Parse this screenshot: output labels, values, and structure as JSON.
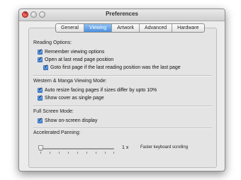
{
  "window": {
    "title": "Preferences"
  },
  "tabs": [
    {
      "label": "General"
    },
    {
      "label": "Viewing",
      "active": true
    },
    {
      "label": "Artwork"
    },
    {
      "label": "Advanced"
    },
    {
      "label": "Hardware"
    }
  ],
  "reading": {
    "title": "Reading Options:",
    "options": [
      {
        "label": "Remember viewing options",
        "checked": true
      },
      {
        "label": "Open at last read page position",
        "checked": true
      },
      {
        "label": "Goto first page if the last reading position was the last page",
        "checked": true
      }
    ]
  },
  "western": {
    "title": "Western & Manga Viewing Mode:",
    "options": [
      {
        "label": "Auto resize facing pages if sizes differ by upto 10%",
        "checked": true
      },
      {
        "label": "Show cover as single page",
        "checked": true
      }
    ]
  },
  "fullscreen": {
    "title": "Full Screen Mode:",
    "options": [
      {
        "label": "Show on-screen display",
        "checked": true
      }
    ]
  },
  "panning": {
    "title": "Accelerated Panning:",
    "value": "1 x",
    "caption": "Faster keyboard scrolling",
    "level": 0
  },
  "icons": {
    "check": "checkmark-icon",
    "close": "close-icon"
  },
  "colors": {
    "accent": "#4a8fe0",
    "close": "#d8302a"
  }
}
